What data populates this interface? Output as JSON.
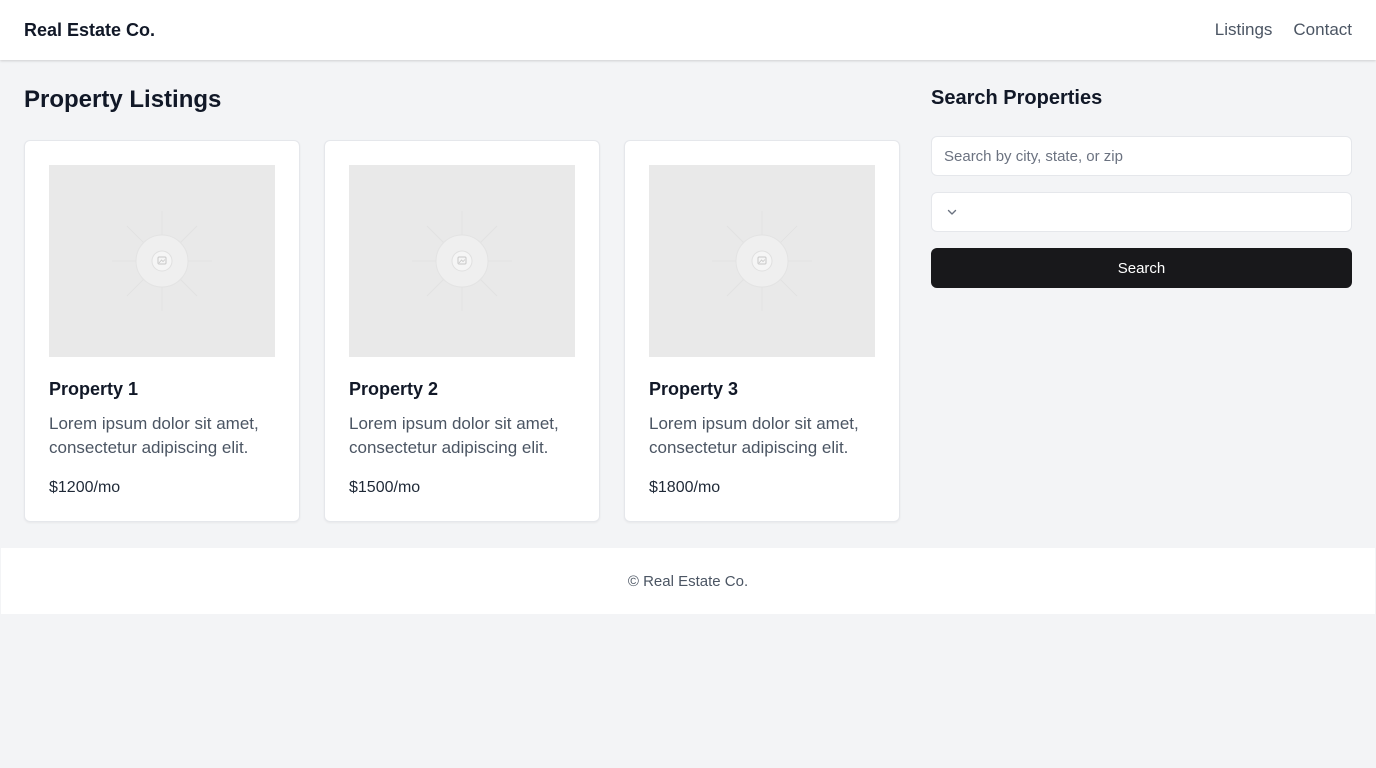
{
  "header": {
    "brand": "Real Estate Co.",
    "nav": [
      "Listings",
      "Contact"
    ]
  },
  "main": {
    "title": "Property Listings",
    "listings": [
      {
        "title": "Property 1",
        "description": "Lorem ipsum dolor sit amet, consectetur adipiscing elit.",
        "price": "$1200/mo",
        "image_icon": "image-placeholder-icon"
      },
      {
        "title": "Property 2",
        "description": "Lorem ipsum dolor sit amet, consectetur adipiscing elit.",
        "price": "$1500/mo",
        "image_icon": "image-placeholder-icon"
      },
      {
        "title": "Property 3",
        "description": "Lorem ipsum dolor sit amet, consectetur adipiscing elit.",
        "price": "$1800/mo",
        "image_icon": "image-placeholder-icon"
      }
    ]
  },
  "sidebar": {
    "title": "Search Properties",
    "search_placeholder": "Search by city, state, or zip",
    "search_value": "",
    "select_value": "",
    "select_icon": "chevron-down-icon",
    "button_label": "Search"
  },
  "footer": {
    "text": "© Real Estate Co."
  },
  "colors": {
    "background": "#f3f4f6",
    "surface": "#ffffff",
    "button": "#18181b",
    "image_placeholder": "#e9e9e9"
  }
}
